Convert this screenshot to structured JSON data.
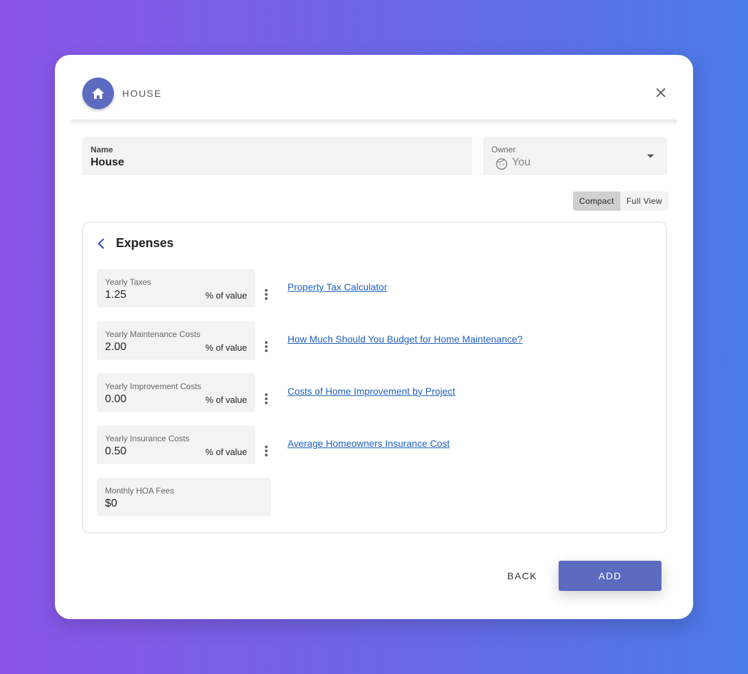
{
  "dialog": {
    "title": "HOUSE",
    "icon": "home-icon"
  },
  "name_field": {
    "label": "Name",
    "value": "House"
  },
  "owner_field": {
    "label": "Owner",
    "value": "You",
    "icon": "face-icon"
  },
  "view_toggle": {
    "compact": "Compact",
    "full": "Full View",
    "selected": "Compact"
  },
  "expenses": {
    "title": "Expenses",
    "items": [
      {
        "label": "Yearly Taxes",
        "value": "1.25",
        "unit": "% of value",
        "link": "Property Tax Calculator"
      },
      {
        "label": "Yearly Maintenance Costs",
        "value": "2.00",
        "unit": "% of value",
        "link": "How Much Should You Budget for Home Maintenance?"
      },
      {
        "label": "Yearly Improvement Costs",
        "value": "0.00",
        "unit": "% of value",
        "link": "Costs of Home Improvement by Project"
      },
      {
        "label": "Yearly Insurance Costs",
        "value": "0.50",
        "unit": "% of value",
        "link": "Average Homeowners Insurance Cost"
      }
    ],
    "hoa": {
      "label": "Monthly HOA Fees",
      "value": "$0"
    }
  },
  "actions": {
    "back": "BACK",
    "add": "ADD"
  },
  "colors": {
    "accent": "#5c6bc0",
    "link": "#1e5fbf"
  }
}
